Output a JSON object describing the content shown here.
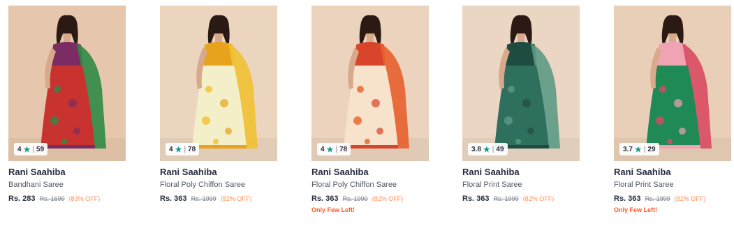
{
  "products": [
    {
      "brand": "Rani Saahiba",
      "name": "Bandhani Saree",
      "price": "Rs. 283",
      "mrp": "Rs. 1699",
      "discount": "(83% OFF)",
      "rating": "4",
      "rating_count": "59",
      "few_left": "",
      "colors": {
        "bg": "#e6c7ad",
        "main": "#c8332f",
        "accent": "#2f8a46",
        "trim": "#7a2c63"
      }
    },
    {
      "brand": "Rani Saahiba",
      "name": "Floral Poly Chiffon Saree",
      "price": "Rs. 363",
      "mrp": "Rs. 1999",
      "discount": "(82% OFF)",
      "rating": "4",
      "rating_count": "78",
      "few_left": "",
      "colors": {
        "bg": "#ebd5bf",
        "main": "#f3efc8",
        "accent": "#f1c232",
        "trim": "#e8a21c"
      }
    },
    {
      "brand": "Rani Saahiba",
      "name": "Floral Poly Chiffon Saree",
      "price": "Rs. 363",
      "mrp": "Rs. 1999",
      "discount": "(82% OFF)",
      "rating": "4",
      "rating_count": "78",
      "few_left": "Only Few Left!",
      "colors": {
        "bg": "#ebd3bd",
        "main": "#f7e2cc",
        "accent": "#e8612c",
        "trim": "#d8452b"
      }
    },
    {
      "brand": "Rani Saahiba",
      "name": "Floral Print Saree",
      "price": "Rs. 363",
      "mrp": "Rs. 1999",
      "discount": "(82% OFF)",
      "rating": "3.8",
      "rating_count": "49",
      "few_left": "",
      "colors": {
        "bg": "#ead6c2",
        "main": "#2f6f5d",
        "accent": "#5c9a86",
        "trim": "#1f4c41"
      }
    },
    {
      "brand": "Rani Saahiba",
      "name": "Floral Print Saree",
      "price": "Rs. 363",
      "mrp": "Rs. 1999",
      "discount": "(82% OFF)",
      "rating": "3.7",
      "rating_count": "29",
      "few_left": "Only Few Left!",
      "colors": {
        "bg": "#e9cfb7",
        "main": "#1f8a55",
        "accent": "#d94a63",
        "trim": "#f0a3b3"
      }
    }
  ]
}
